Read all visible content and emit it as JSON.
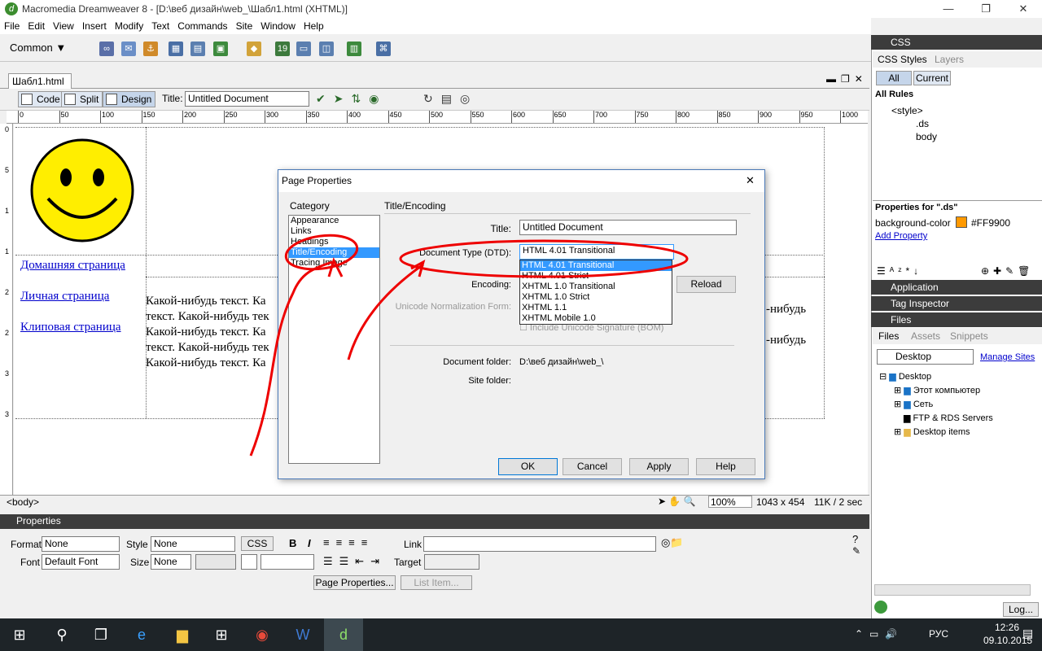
{
  "window": {
    "title": "Macromedia Dreamweaver 8 - [D:\\веб дизайн\\web_\\Шабл1.html (XHTML)]",
    "minimize": "—",
    "restore": "❐",
    "close": "✕"
  },
  "menu": [
    "File",
    "Edit",
    "View",
    "Insert",
    "Modify",
    "Text",
    "Commands",
    "Site",
    "Window",
    "Help"
  ],
  "insertbar": {
    "category": "Common ▼"
  },
  "document": {
    "tab": "Шабл1.html",
    "views": {
      "code": "Code",
      "split": "Split",
      "design": "Design"
    },
    "title_label": "Title:",
    "title_value": "Untitled Document",
    "ruler": [
      "0",
      "50",
      "100",
      "150",
      "200",
      "250",
      "300",
      "350",
      "400",
      "450",
      "500",
      "550",
      "600",
      "650",
      "700",
      "750",
      "800",
      "850",
      "900",
      "950",
      "1000"
    ],
    "vruler": [
      "0",
      "5",
      "1",
      "1",
      "2",
      "2",
      "3",
      "3"
    ],
    "links": [
      "Домашняя страница",
      "Личная страница",
      "Клиповая страница"
    ],
    "text_lines": [
      "Какой-нибудь текст. Ка",
      "текст. Какой-нибудь тек",
      "Какой-нибудь текст. Ка",
      "текст. Какой-нибудь тек",
      "Какой-нибудь текст. Ка"
    ],
    "text_right": [
      "-нибудь",
      "-нибудь"
    ]
  },
  "status": {
    "tag": "<body>",
    "zoom": "100%",
    "size": "1043 x 454",
    "weight": "11K / 2 sec"
  },
  "properties": {
    "header": "Properties",
    "format_label": "Format",
    "format_value": "None",
    "style_label": "Style",
    "style_value": "None",
    "css_button": "CSS",
    "bold": "B",
    "italic": "I",
    "link_label": "Link",
    "font_label": "Font",
    "font_value": "Default Font",
    "size_label": "Size",
    "size_value": "None",
    "target_label": "Target",
    "page_properties_button": "Page Properties...",
    "list_item_button": "List Item..."
  },
  "css_panel": {
    "header": "CSS",
    "tabs": [
      "CSS Styles",
      "Layers"
    ],
    "mode_all": "All",
    "mode_current": "Current",
    "all_rules": "All Rules",
    "rules": [
      "<style>",
      ".ds",
      "body"
    ],
    "props_title": "Properties for \".ds\"",
    "prop_name": "background-color",
    "prop_value": "#FF9900",
    "add_property": "Add Property",
    "accent": "#FF9900"
  },
  "collapsed_panels": [
    "Application",
    "Tag Inspector"
  ],
  "files_panel": {
    "header": "Files",
    "tabs": [
      "Files",
      "Assets",
      "Snippets"
    ],
    "site": "Desktop",
    "manage_sites": "Manage Sites",
    "tree": [
      "Desktop",
      "Этот компьютер",
      "Сеть",
      "FTP & RDS Servers",
      "Desktop items"
    ],
    "log_button": "Log..."
  },
  "dialog": {
    "title": "Page Properties",
    "close": "✕",
    "category_label": "Category",
    "categories": [
      "Appearance",
      "Links",
      "Headings",
      "Title/Encoding",
      "Tracing Image"
    ],
    "selected_category": "Title/Encoding",
    "section_title": "Title/Encoding",
    "title_label": "Title:",
    "title_value": "Untitled Document",
    "dtd_label": "Document Type (DTD):",
    "dtd_value": "HTML 4.01 Transitional",
    "dtd_options": [
      "HTML 4.01 Transitional",
      "HTML 4.01 Strict",
      "XHTML 1.0 Transitional",
      "XHTML 1.0 Strict",
      "XHTML 1.1",
      "XHTML Mobile 1.0"
    ],
    "encoding_label": "Encoding:",
    "reload_button": "Reload",
    "normalization_label": "Unicode Normalization Form:",
    "bom_label": "Include Unicode Signature (BOM)",
    "doc_folder_label": "Document folder:",
    "doc_folder_value": "D:\\веб дизайн\\web_\\",
    "site_folder_label": "Site folder:",
    "ok": "OK",
    "cancel": "Cancel",
    "apply": "Apply",
    "help": "Help"
  },
  "taskbar": {
    "lang": "РУС",
    "time": "12:26",
    "date": "09.10.2015"
  }
}
